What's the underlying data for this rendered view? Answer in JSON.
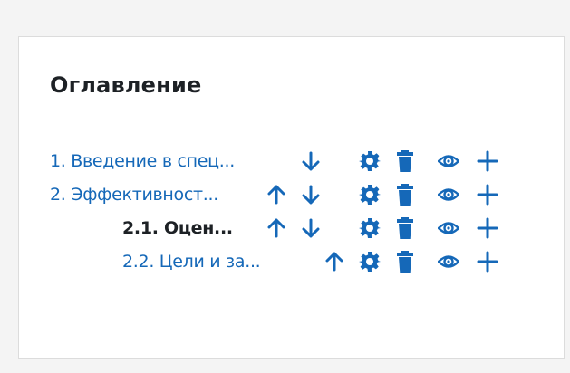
{
  "toc": {
    "heading": "Оглавление",
    "items": [
      {
        "label": "1. Введение в спец...",
        "current": false,
        "indent": 0,
        "actions": [
          "down",
          "settings",
          "delete",
          "visibility",
          "add"
        ]
      },
      {
        "label": "2. Эффективност...",
        "current": false,
        "indent": 0,
        "actions": [
          "up",
          "down",
          "settings",
          "delete",
          "visibility",
          "add"
        ]
      },
      {
        "label": "2.1. Оцен...",
        "current": true,
        "indent": 1,
        "actions": [
          "up",
          "down",
          "settings",
          "delete",
          "visibility",
          "add"
        ]
      },
      {
        "label": "2.2. Цели и за...",
        "current": false,
        "indent": 1,
        "actions": [
          "up",
          "settings",
          "delete",
          "visibility",
          "add"
        ]
      }
    ]
  },
  "colors": {
    "link": "#1568b8",
    "icon": "#1568b8",
    "text": "#1d2125",
    "card_border": "#dcdcdc",
    "page_background": "#f4f4f4"
  },
  "icons": {
    "up": "arrow-up-icon",
    "down": "arrow-down-icon",
    "settings": "gear-icon",
    "delete": "trash-icon",
    "visibility": "eye-icon",
    "add": "plus-icon"
  }
}
